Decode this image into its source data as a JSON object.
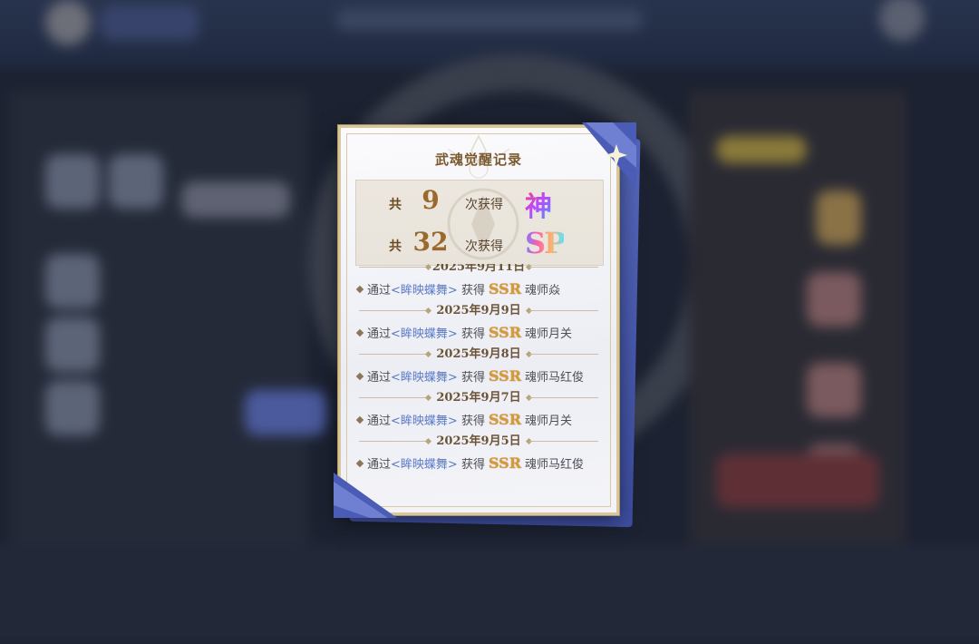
{
  "dialog": {
    "title": "武魂觉醒记录",
    "summary": [
      {
        "prefix": "共",
        "count": "9",
        "suffix": "次获得",
        "badge": "神"
      },
      {
        "prefix": "共",
        "count": "32",
        "suffix": "次获得",
        "badge": "SP"
      }
    ],
    "records": [
      {
        "date": "2025年9月11日",
        "via": "通过",
        "source": "<眸映蝶舞>",
        "get": "获得",
        "rarity": "SSR",
        "result": "魂师焱"
      },
      {
        "date": "2025年9月9日",
        "via": "通过",
        "source": "<眸映蝶舞>",
        "get": "获得",
        "rarity": "SSR",
        "result": "魂师月关"
      },
      {
        "date": "2025年9月8日",
        "via": "通过",
        "source": "<眸映蝶舞>",
        "get": "获得",
        "rarity": "SSR",
        "result": "魂师马红俊"
      },
      {
        "date": "2025年9月7日",
        "via": "通过",
        "source": "<眸映蝶舞>",
        "get": "获得",
        "rarity": "SSR",
        "result": "魂师月关"
      },
      {
        "date": "2025年9月5日",
        "via": "通过",
        "source": "<眸映蝶舞>",
        "get": "获得",
        "rarity": "SSR",
        "result": "魂师马红俊"
      }
    ]
  },
  "colors": {
    "card_border": "#d9c79a",
    "ribbon_blue": "#4a5cb5",
    "source_link": "#5b79c8",
    "ssr_gold": "#d79a3a",
    "count_gold": "#9a6a2c"
  },
  "icons": {
    "corner_ribbon": "star-ribbon-icon",
    "bullet": "diamond-bullet-icon",
    "title_emblem": "emblem-icon"
  }
}
